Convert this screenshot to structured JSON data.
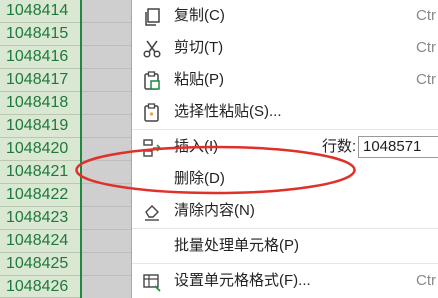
{
  "sheet": {
    "rows": [
      "1048414",
      "1048415",
      "1048416",
      "1048417",
      "1048418",
      "1048419",
      "1048420",
      "1048421",
      "1048422",
      "1048423",
      "1048424",
      "1048425",
      "1048426"
    ]
  },
  "menu": {
    "copy": {
      "label": "复制(C)",
      "shortcut": "Ctr",
      "icon": "copy-icon"
    },
    "cut": {
      "label": "剪切(T)",
      "shortcut": "Ctr",
      "icon": "scissors-icon"
    },
    "paste": {
      "label": "粘贴(P)",
      "shortcut": "Ctr",
      "icon": "paste-icon"
    },
    "paste_special": {
      "label": "选择性粘贴(S)...",
      "icon": "paste-special-icon"
    },
    "insert": {
      "label": "插入(I)",
      "icon": "insert-row-icon",
      "row_count_label": "行数:",
      "row_count_value": "1048571"
    },
    "delete": {
      "label": "删除(D)"
    },
    "clear": {
      "label": "清除内容(N)",
      "icon": "eraser-icon"
    },
    "batch": {
      "label": "批量处理单元格(P)"
    },
    "format": {
      "label": "设置单元格格式(F)...",
      "shortcut": "Ctr",
      "icon": "format-cells-icon"
    }
  },
  "colors": {
    "row_text": "#1e7a3a",
    "highlight_ellipse": "#e0302a"
  }
}
